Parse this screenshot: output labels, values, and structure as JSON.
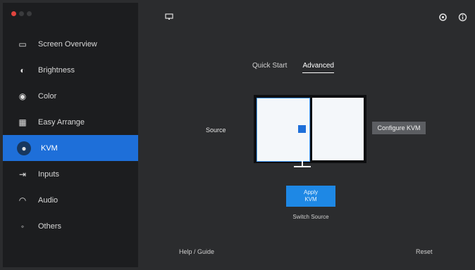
{
  "colors": {
    "background": "#2b2c2e",
    "sidebar": "#1c1d1f",
    "accent": "#1e6fd9",
    "apply_button": "#1e88e5",
    "window_dot_close": "#e0443e",
    "window_dot_min": "#3a3b3d",
    "window_dot_max": "#3a3b3d"
  },
  "sidebar": {
    "items": [
      {
        "icon": "display-icon",
        "glyph": "▭",
        "label": "Screen Overview"
      },
      {
        "icon": "brightness-icon",
        "glyph": "◐",
        "label": "Brightness"
      },
      {
        "icon": "color-icon",
        "glyph": "◉",
        "label": "Color"
      },
      {
        "icon": "layout-icon",
        "glyph": "▦",
        "label": "Easy Arrange"
      },
      {
        "icon": "kvm-icon",
        "glyph": "●",
        "label": "KVM"
      },
      {
        "icon": "inputs-icon",
        "glyph": "⇥",
        "label": "Inputs"
      },
      {
        "icon": "audio-icon",
        "glyph": "◠",
        "label": "Audio"
      },
      {
        "icon": "others-icon",
        "glyph": "◦",
        "label": "Others"
      }
    ],
    "active_index": 4
  },
  "header": {
    "title_icon": "monitor-small-icon",
    "right_icons": [
      "settings-icon",
      "info-icon"
    ]
  },
  "tabs": [
    {
      "label": "Quick Start"
    },
    {
      "label": "Advanced"
    }
  ],
  "active_tab": 1,
  "monitor": {
    "left_label": "Source",
    "right_button": "Configure KVM"
  },
  "apply": {
    "line1": "Apply",
    "line2": "KVM",
    "caption": "Switch Source"
  },
  "footer": {
    "left_link": "Help / Guide",
    "right_link": "Reset"
  }
}
